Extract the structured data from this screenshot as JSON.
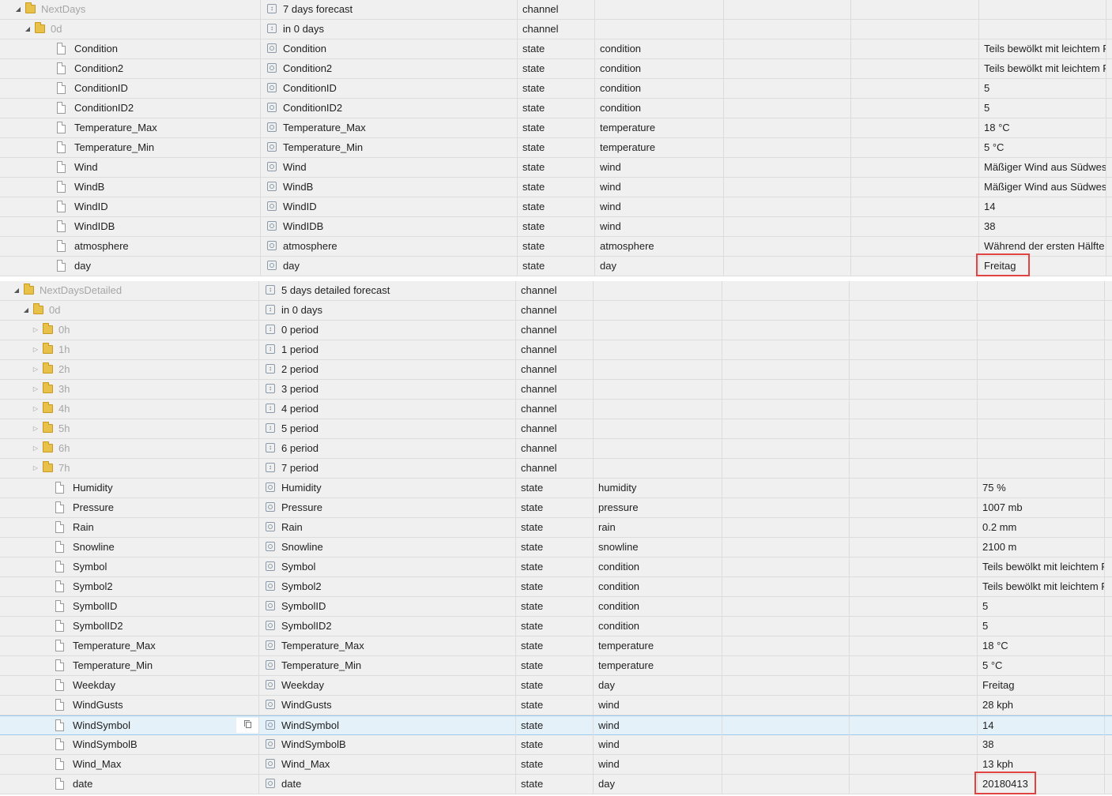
{
  "tree1": {
    "rows": [
      {
        "level": 0,
        "kind": "folder",
        "expanded": true,
        "name": "NextDays",
        "label_icon": "channel",
        "label": "7 days forecast",
        "type": "channel",
        "role": "",
        "value": ""
      },
      {
        "level": 1,
        "kind": "folder",
        "expanded": true,
        "name": "0d",
        "label_icon": "channel",
        "label": "in 0 days",
        "type": "channel",
        "role": "",
        "value": ""
      },
      {
        "level": 2,
        "kind": "file",
        "name": "Condition",
        "label_icon": "state",
        "label": "Condition",
        "type": "state",
        "role": "condition",
        "value": "Teils bewölkt mit leichtem Regen"
      },
      {
        "level": 2,
        "kind": "file",
        "name": "Condition2",
        "label_icon": "state",
        "label": "Condition2",
        "type": "state",
        "role": "condition",
        "value": "Teils bewölkt mit leichtem Regen"
      },
      {
        "level": 2,
        "kind": "file",
        "name": "ConditionID",
        "label_icon": "state",
        "label": "ConditionID",
        "type": "state",
        "role": "condition",
        "value": "5"
      },
      {
        "level": 2,
        "kind": "file",
        "name": "ConditionID2",
        "label_icon": "state",
        "label": "ConditionID2",
        "type": "state",
        "role": "condition",
        "value": "5"
      },
      {
        "level": 2,
        "kind": "file",
        "name": "Temperature_Max",
        "label_icon": "state",
        "label": "Temperature_Max",
        "type": "state",
        "role": "temperature",
        "value": "18 °C"
      },
      {
        "level": 2,
        "kind": "file",
        "name": "Temperature_Min",
        "label_icon": "state",
        "label": "Temperature_Min",
        "type": "state",
        "role": "temperature",
        "value": "5 °C"
      },
      {
        "level": 2,
        "kind": "file",
        "name": "Wind",
        "label_icon": "state",
        "label": "Wind",
        "type": "state",
        "role": "wind",
        "value": "Mäßiger Wind aus Südwest"
      },
      {
        "level": 2,
        "kind": "file",
        "name": "WindB",
        "label_icon": "state",
        "label": "WindB",
        "type": "state",
        "role": "wind",
        "value": "Mäßiger Wind aus Südwest"
      },
      {
        "level": 2,
        "kind": "file",
        "name": "WindID",
        "label_icon": "state",
        "label": "WindID",
        "type": "state",
        "role": "wind",
        "value": "14"
      },
      {
        "level": 2,
        "kind": "file",
        "name": "WindIDB",
        "label_icon": "state",
        "label": "WindIDB",
        "type": "state",
        "role": "wind",
        "value": "38"
      },
      {
        "level": 2,
        "kind": "file",
        "name": "atmosphere",
        "label_icon": "state",
        "label": "atmosphere",
        "type": "state",
        "role": "atmosphere",
        "value": "Während der ersten Hälfte"
      },
      {
        "level": 2,
        "kind": "file",
        "name": "day",
        "label_icon": "state",
        "label": "day",
        "type": "state",
        "role": "day",
        "value": "Freitag",
        "highlight": true
      }
    ]
  },
  "tree2": {
    "rows": [
      {
        "level": 0,
        "kind": "folder",
        "expanded": true,
        "name": "NextDaysDetailed",
        "label_icon": "channel",
        "label": "5 days detailed forecast",
        "type": "channel",
        "role": "",
        "value": ""
      },
      {
        "level": 1,
        "kind": "folder",
        "expanded": true,
        "name": "0d",
        "label_icon": "channel",
        "label": "in 0 days",
        "type": "channel",
        "role": "",
        "value": ""
      },
      {
        "level": 2,
        "kind": "folder",
        "expanded": false,
        "name": "0h",
        "label_icon": "channel",
        "label": "0 period",
        "type": "channel",
        "role": "",
        "value": ""
      },
      {
        "level": 2,
        "kind": "folder",
        "expanded": false,
        "name": "1h",
        "label_icon": "channel",
        "label": "1 period",
        "type": "channel",
        "role": "",
        "value": ""
      },
      {
        "level": 2,
        "kind": "folder",
        "expanded": false,
        "name": "2h",
        "label_icon": "channel",
        "label": "2 period",
        "type": "channel",
        "role": "",
        "value": ""
      },
      {
        "level": 2,
        "kind": "folder",
        "expanded": false,
        "name": "3h",
        "label_icon": "channel",
        "label": "3 period",
        "type": "channel",
        "role": "",
        "value": ""
      },
      {
        "level": 2,
        "kind": "folder",
        "expanded": false,
        "name": "4h",
        "label_icon": "channel",
        "label": "4 period",
        "type": "channel",
        "role": "",
        "value": ""
      },
      {
        "level": 2,
        "kind": "folder",
        "expanded": false,
        "name": "5h",
        "label_icon": "channel",
        "label": "5 period",
        "type": "channel",
        "role": "",
        "value": ""
      },
      {
        "level": 2,
        "kind": "folder",
        "expanded": false,
        "name": "6h",
        "label_icon": "channel",
        "label": "6 period",
        "type": "channel",
        "role": "",
        "value": ""
      },
      {
        "level": 2,
        "kind": "folder",
        "expanded": false,
        "name": "7h",
        "label_icon": "channel",
        "label": "7 period",
        "type": "channel",
        "role": "",
        "value": ""
      },
      {
        "level": 2,
        "kind": "file",
        "name": "Humidity",
        "label_icon": "state",
        "label": "Humidity",
        "type": "state",
        "role": "humidity",
        "value": "75 %"
      },
      {
        "level": 2,
        "kind": "file",
        "name": "Pressure",
        "label_icon": "state",
        "label": "Pressure",
        "type": "state",
        "role": "pressure",
        "value": "1007 mb"
      },
      {
        "level": 2,
        "kind": "file",
        "name": "Rain",
        "label_icon": "state",
        "label": "Rain",
        "type": "state",
        "role": "rain",
        "value": "0.2 mm"
      },
      {
        "level": 2,
        "kind": "file",
        "name": "Snowline",
        "label_icon": "state",
        "label": "Snowline",
        "type": "state",
        "role": "snowline",
        "value": "2100 m"
      },
      {
        "level": 2,
        "kind": "file",
        "name": "Symbol",
        "label_icon": "state",
        "label": "Symbol",
        "type": "state",
        "role": "condition",
        "value": "Teils bewölkt mit leichtem Regen"
      },
      {
        "level": 2,
        "kind": "file",
        "name": "Symbol2",
        "label_icon": "state",
        "label": "Symbol2",
        "type": "state",
        "role": "condition",
        "value": "Teils bewölkt mit leichtem Regen"
      },
      {
        "level": 2,
        "kind": "file",
        "name": "SymbolID",
        "label_icon": "state",
        "label": "SymbolID",
        "type": "state",
        "role": "condition",
        "value": "5"
      },
      {
        "level": 2,
        "kind": "file",
        "name": "SymbolID2",
        "label_icon": "state",
        "label": "SymbolID2",
        "type": "state",
        "role": "condition",
        "value": "5"
      },
      {
        "level": 2,
        "kind": "file",
        "name": "Temperature_Max",
        "label_icon": "state",
        "label": "Temperature_Max",
        "type": "state",
        "role": "temperature",
        "value": "18 °C"
      },
      {
        "level": 2,
        "kind": "file",
        "name": "Temperature_Min",
        "label_icon": "state",
        "label": "Temperature_Min",
        "type": "state",
        "role": "temperature",
        "value": "5 °C"
      },
      {
        "level": 2,
        "kind": "file",
        "name": "Weekday",
        "label_icon": "state",
        "label": "Weekday",
        "type": "state",
        "role": "day",
        "value": "Freitag"
      },
      {
        "level": 2,
        "kind": "file",
        "name": "WindGusts",
        "label_icon": "state",
        "label": "WindGusts",
        "type": "state",
        "role": "wind",
        "value": "28 kph"
      },
      {
        "level": 2,
        "kind": "file",
        "name": "WindSymbol",
        "label_icon": "state",
        "label": "WindSymbol",
        "type": "state",
        "role": "wind",
        "value": "14",
        "selected": true
      },
      {
        "level": 2,
        "kind": "file",
        "name": "WindSymbolB",
        "label_icon": "state",
        "label": "WindSymbolB",
        "type": "state",
        "role": "wind",
        "value": "38"
      },
      {
        "level": 2,
        "kind": "file",
        "name": "Wind_Max",
        "label_icon": "state",
        "label": "Wind_Max",
        "type": "state",
        "role": "wind",
        "value": "13 kph"
      },
      {
        "level": 2,
        "kind": "file",
        "name": "date",
        "label_icon": "state",
        "label": "date",
        "type": "state",
        "role": "day",
        "value": "20180413",
        "highlight": true
      }
    ]
  },
  "colors": {
    "highlight": "#e14343",
    "selection": "#e5f1f9",
    "folder": "#e8c14a"
  }
}
